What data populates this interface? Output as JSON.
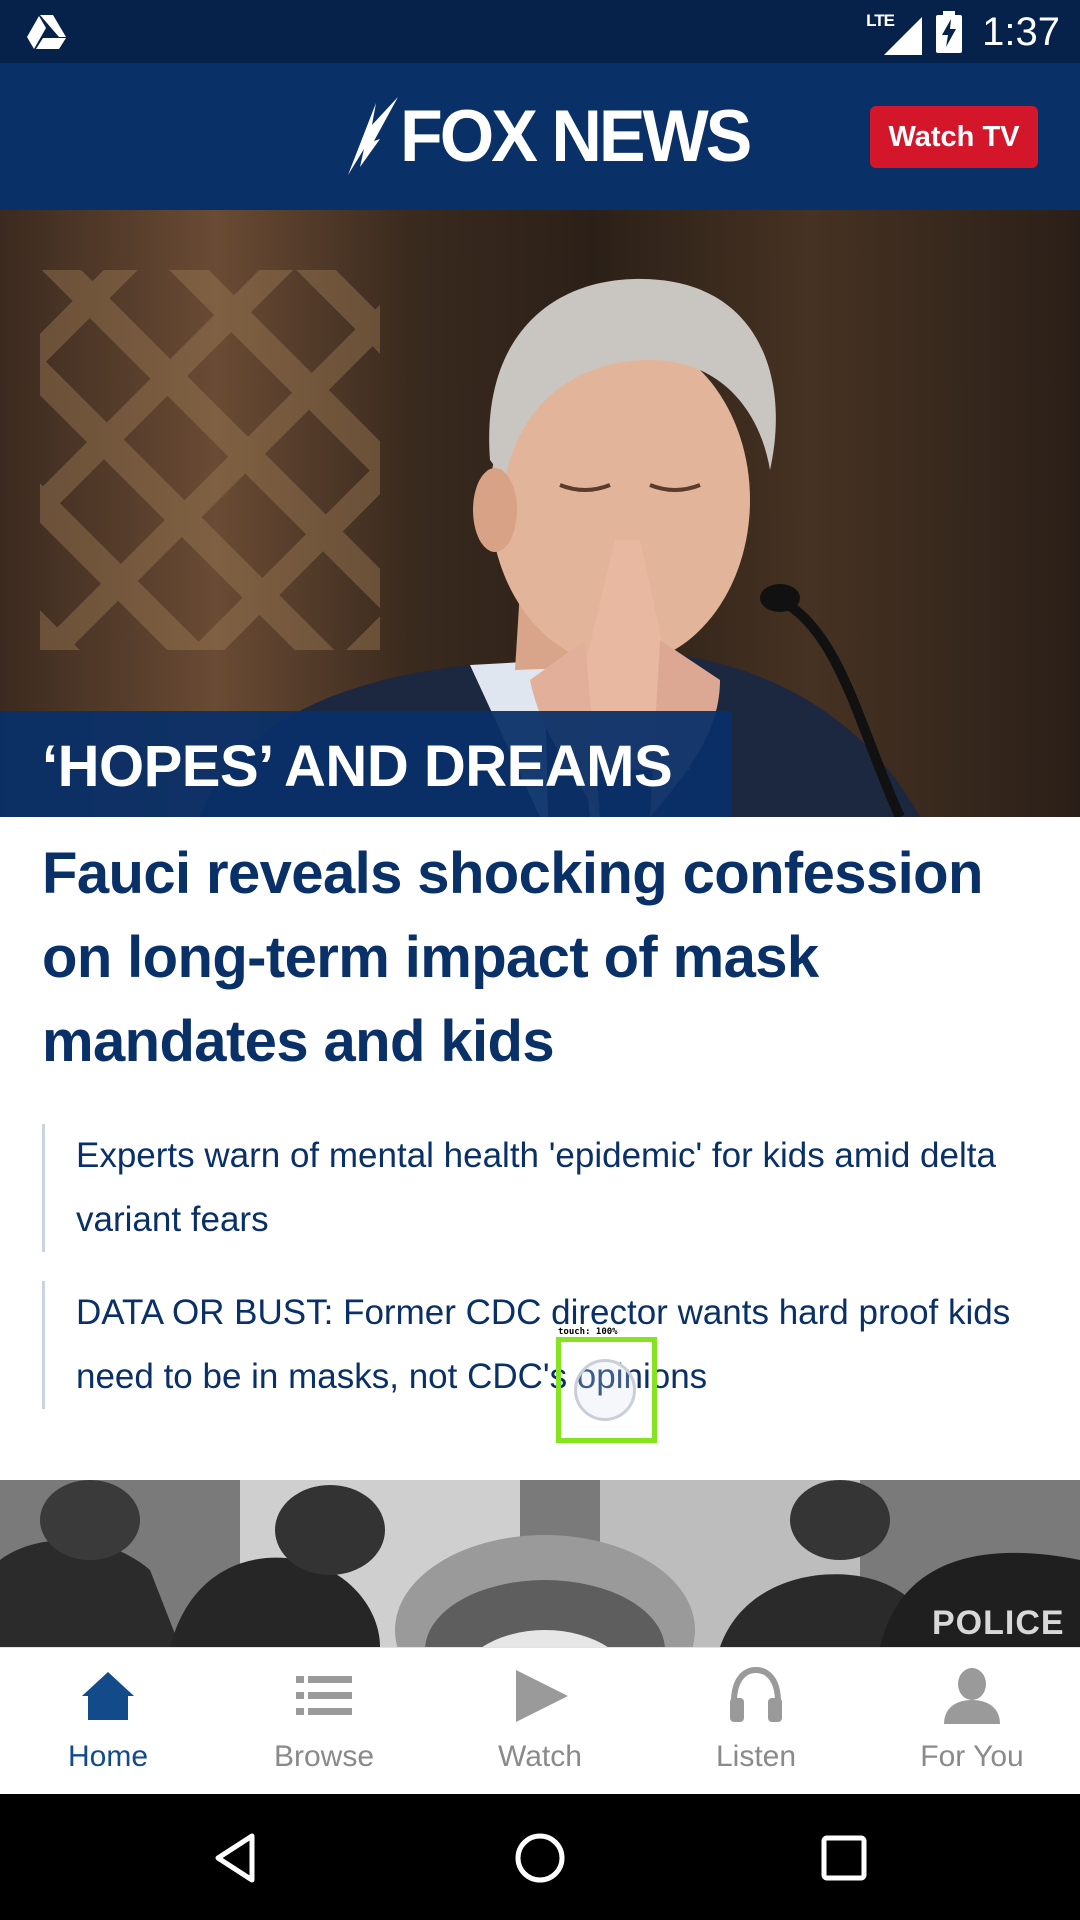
{
  "status_bar": {
    "network": "LTE",
    "time": "1:37",
    "icons": [
      "drive-icon",
      "signal-icon",
      "battery-charging-icon"
    ]
  },
  "header": {
    "logo_text": "FOX NEWS",
    "watch_tv_label": "Watch TV",
    "colors": {
      "header_bg": "#0a3068",
      "watch_tv_bg": "#d3162a"
    }
  },
  "hero": {
    "kicker": "‘HOPES’ AND DREAMS",
    "headline": "Fauci reveals shocking confession on long-term impact of mask mandates and kids"
  },
  "related": [
    {
      "text": "Experts warn of mental health 'epidemic' for kids amid delta variant fears"
    },
    {
      "text": "DATA OR BUST: Former CDC director wants hard proof kids need to be in masks, not CDC's opinions"
    }
  ],
  "touch_overlay": {
    "label": "touch: 100%"
  },
  "second_story": {
    "image_text": "POLICE"
  },
  "bottom_nav": {
    "items": [
      {
        "label": "Home",
        "icon": "home-icon",
        "active": true
      },
      {
        "label": "Browse",
        "icon": "list-icon",
        "active": false
      },
      {
        "label": "Watch",
        "icon": "play-icon",
        "active": false
      },
      {
        "label": "Listen",
        "icon": "headphones-icon",
        "active": false
      },
      {
        "label": "For You",
        "icon": "person-icon",
        "active": false
      }
    ]
  },
  "system_nav": {
    "icons": [
      "back-icon",
      "home-circle-icon",
      "recents-icon"
    ]
  }
}
